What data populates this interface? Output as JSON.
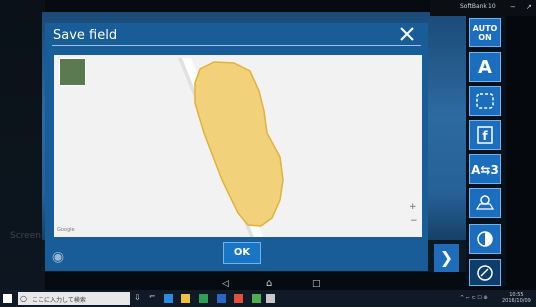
{
  "dialog": {
    "title": "Save field",
    "ok_label": "OK",
    "close_icon": "close-icon",
    "map": {
      "attribution": "Google",
      "zoom_in_label": "+",
      "zoom_out_label": "−"
    }
  },
  "toolbar": {
    "auto_line1": "AUTO",
    "auto_line2": "ON",
    "a_label": "A",
    "ab3_label": "A⇆3"
  },
  "background": {
    "watermark": "Screen"
  },
  "status_bar": {
    "carrier": "SoftBank",
    "battery": "10"
  },
  "taskbar": {
    "search_placeholder": "ここに入力して検索",
    "time": "10:55",
    "date": "2016/10/09",
    "tray_icons_label": "^ ⌐ ⊂ ☐ ⊕"
  },
  "colors": {
    "dialog_bg": "#185d97",
    "button_blue": "#1b6dbd",
    "field_fill": "#f1d27a",
    "field_stroke": "#e0b23a"
  }
}
